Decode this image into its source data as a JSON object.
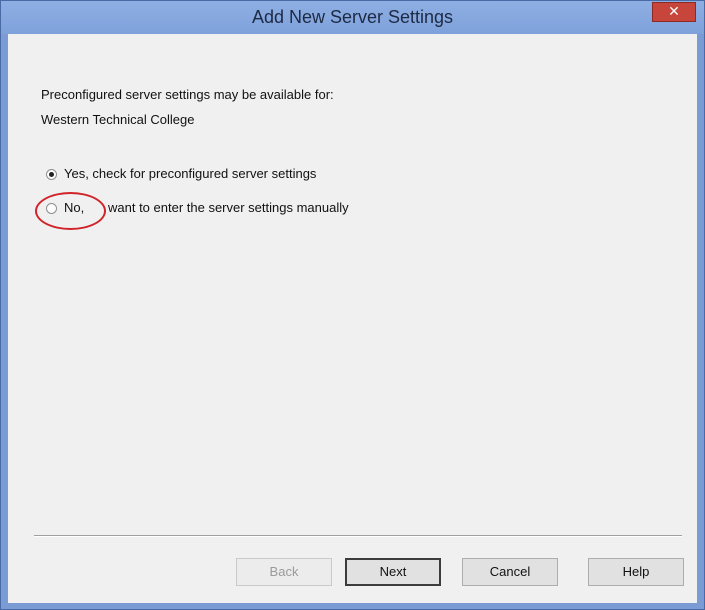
{
  "window": {
    "title": "Add New Server Settings",
    "close_glyph": "✕"
  },
  "content": {
    "intro_line": "Preconfigured server settings may be available for:",
    "institution": "Western Technical College",
    "options": [
      {
        "label": "Yes, check for preconfigured server settings",
        "selected": true
      },
      {
        "label": "No,",
        "selected": false
      }
    ],
    "option2_rest": "want to enter the server settings manually"
  },
  "buttons": {
    "back": "Back",
    "next": "Next",
    "cancel": "Cancel",
    "help": "Help"
  },
  "colors": {
    "titlebar": "#7fa1db",
    "client": "#f0f0f0",
    "annotation": "#d0242a"
  }
}
